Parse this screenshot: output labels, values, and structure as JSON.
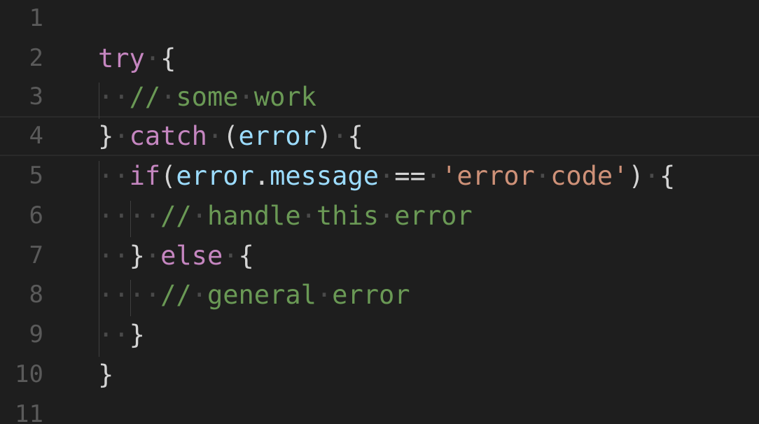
{
  "editor": {
    "lines": [
      {
        "n": "1",
        "tokens": []
      },
      {
        "n": "2",
        "tokens": [
          [
            "kw",
            "try"
          ],
          [
            "ws",
            "·"
          ],
          [
            "pun",
            "{"
          ]
        ]
      },
      {
        "n": "3",
        "tokens": [
          [
            "ws",
            "··"
          ],
          [
            "cm",
            "//"
          ],
          [
            "ws",
            "·"
          ],
          [
            "cm",
            "some"
          ],
          [
            "ws",
            "·"
          ],
          [
            "cm",
            "work"
          ]
        ]
      },
      {
        "n": "4",
        "tokens": [
          [
            "pun",
            "}"
          ],
          [
            "ws",
            "·"
          ],
          [
            "kw",
            "catch"
          ],
          [
            "ws",
            "·"
          ],
          [
            "pun",
            "("
          ],
          [
            "var",
            "error"
          ],
          [
            "pun",
            ")"
          ],
          [
            "ws",
            "·"
          ],
          [
            "pun",
            "{"
          ]
        ]
      },
      {
        "n": "5",
        "tokens": [
          [
            "ws",
            "··"
          ],
          [
            "kw",
            "if"
          ],
          [
            "pun",
            "("
          ],
          [
            "var",
            "error"
          ],
          [
            "pun",
            "."
          ],
          [
            "var",
            "message"
          ],
          [
            "ws",
            "·"
          ],
          [
            "pun",
            "=="
          ],
          [
            "ws",
            "·"
          ],
          [
            "str",
            "'error"
          ],
          [
            "ws",
            "·"
          ],
          [
            "str",
            "code'"
          ],
          [
            "pun",
            ")"
          ],
          [
            "ws",
            "·"
          ],
          [
            "pun",
            "{"
          ]
        ]
      },
      {
        "n": "6",
        "tokens": [
          [
            "ws",
            "····"
          ],
          [
            "cm",
            "//"
          ],
          [
            "ws",
            "·"
          ],
          [
            "cm",
            "handle"
          ],
          [
            "ws",
            "·"
          ],
          [
            "cm",
            "this"
          ],
          [
            "ws",
            "·"
          ],
          [
            "cm",
            "error"
          ]
        ]
      },
      {
        "n": "7",
        "tokens": [
          [
            "ws",
            "··"
          ],
          [
            "pun",
            "}"
          ],
          [
            "ws",
            "·"
          ],
          [
            "kw",
            "else"
          ],
          [
            "ws",
            "·"
          ],
          [
            "pun",
            "{"
          ]
        ]
      },
      {
        "n": "8",
        "tokens": [
          [
            "ws",
            "····"
          ],
          [
            "cm",
            "//"
          ],
          [
            "ws",
            "·"
          ],
          [
            "cm",
            "general"
          ],
          [
            "ws",
            "·"
          ],
          [
            "cm",
            "error"
          ]
        ]
      },
      {
        "n": "9",
        "tokens": [
          [
            "ws",
            "··"
          ],
          [
            "pun",
            "}"
          ]
        ]
      },
      {
        "n": "10",
        "tokens": [
          [
            "pun",
            "}"
          ]
        ]
      },
      {
        "n": "11",
        "tokens": []
      }
    ],
    "current_line": "4"
  }
}
